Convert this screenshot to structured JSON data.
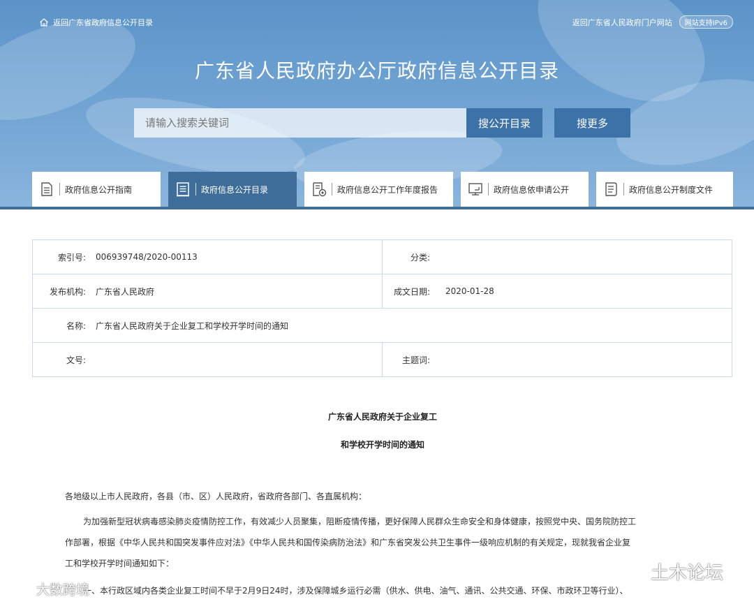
{
  "header": {
    "back_link": "返回广东省政府信息公开目录",
    "portal_link": "返回广东省人民政府门户网站",
    "ipv6_badge": "网站支持IPv6",
    "title": "广东省人民政府办公厅政府信息公开目录"
  },
  "search": {
    "placeholder": "请输入搜索关键词",
    "primary_label": "搜公开目录",
    "more_label": "搜更多"
  },
  "tabs": [
    {
      "label": "政府信息公开指南",
      "icon": "document-icon",
      "active": false
    },
    {
      "label": "政府信息公开目录",
      "icon": "catalog-icon",
      "active": true
    },
    {
      "label": "政府信息公开工作年度报告",
      "icon": "report-icon",
      "active": false
    },
    {
      "label": "政府信息依申请公开",
      "icon": "monitor-icon",
      "active": false
    },
    {
      "label": "政府信息公开制度文件",
      "icon": "file-list-icon",
      "active": false
    }
  ],
  "meta": {
    "index_label": "索引号:",
    "index_value": "006939748/2020-00113",
    "category_label": "分类:",
    "category_value": "",
    "publisher_label": "发布机构:",
    "publisher_value": "广东省人民政府",
    "date_label": "成文日期:",
    "date_value": "2020-01-28",
    "name_label": "名称:",
    "name_value": "广东省人民政府关于企业复工和学校开学时间的通知",
    "docno_label": "文号:",
    "docno_value": "",
    "keywords_label": "主题词:",
    "keywords_value": ""
  },
  "document": {
    "title_line1": "广东省人民政府关于企业复工",
    "title_line2": "和学校开学时间的通知",
    "salutation": "各地级以上市人民政府，各县（市、区）人民政府，省政府各部门、各直属机构：",
    "para1_line1": "为加强新型冠状病毒感染肺炎疫情防控工作，有效减少人员聚集，阻断疫情传播，更好保障人民群众生命安全和身体健康，按照党中央、国务院防控工",
    "para1_line2": "作部署，根据《中华人民共和国突发事件应对法》《中华人民共和国传染病防治法》和广东省突发公共卫生事件一级响应机制的有关规定，现就我省企业复",
    "para1_line3": "工和学校开学时间通知如下：",
    "para2_line1": "一、本行政区域内各类企业复工时间不早于2月9日24时，涉及保障城乡运行必需（供水、供电、油气、通讯、公共交通、环保、市政环卫等行业）、"
  },
  "watermarks": {
    "left": "大数跨境",
    "right": "土木论坛"
  },
  "colors": {
    "banner": "#6ea2d2",
    "accent": "#3e6d99",
    "button": "#3c72a8",
    "table_border": "#c9dbea"
  }
}
